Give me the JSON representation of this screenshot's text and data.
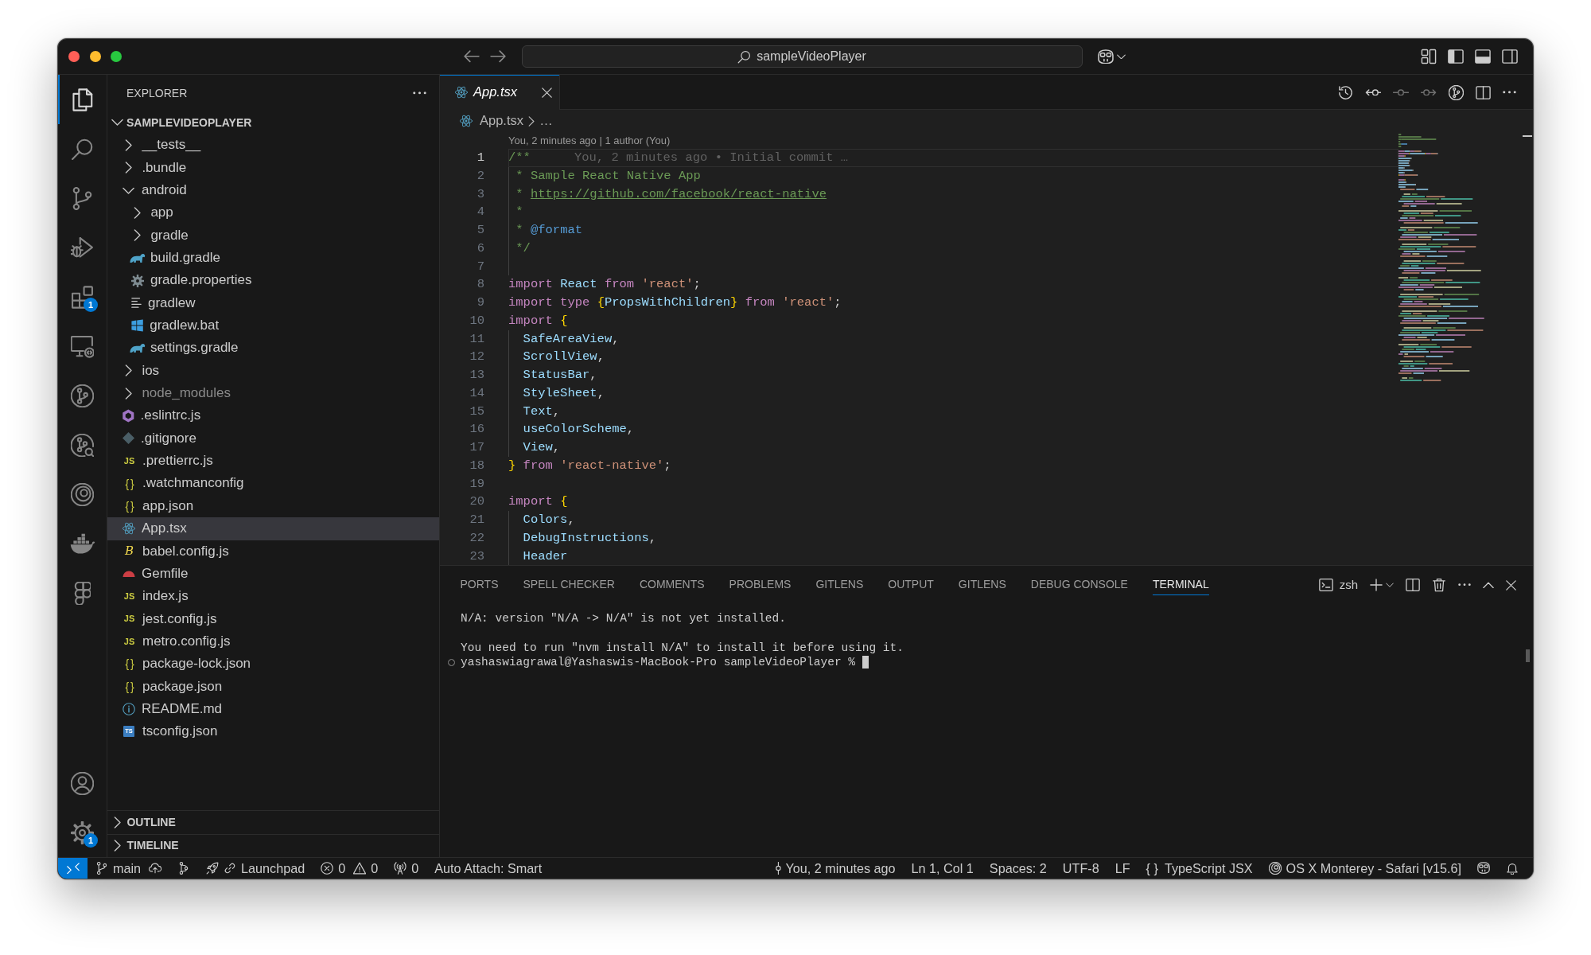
{
  "title_bar": {
    "command_center": {
      "label": "sampleVideoPlayer"
    }
  },
  "activity_bar": {
    "items": [
      {
        "kind": "explorer",
        "selected": true
      },
      {
        "kind": "search",
        "selected": false
      },
      {
        "kind": "source-control",
        "selected": false
      },
      {
        "kind": "run-debug",
        "selected": false
      },
      {
        "kind": "extensions",
        "selected": false,
        "badge": "1"
      },
      {
        "kind": "remote",
        "selected": false
      },
      {
        "kind": "gitlens",
        "selected": false
      },
      {
        "kind": "gitlens-inspect",
        "selected": false
      },
      {
        "kind": "spiral",
        "selected": false
      },
      {
        "kind": "docker",
        "selected": false
      },
      {
        "kind": "shapes",
        "selected": false
      }
    ],
    "bottom": [
      {
        "kind": "account"
      },
      {
        "kind": "manage",
        "badge": "1"
      }
    ]
  },
  "sidebar": {
    "title": "EXPLORER",
    "sections": [
      {
        "title": "SAMPLEVIDEOPLAYER",
        "expanded": true,
        "tree": [
          {
            "label": "__tests__",
            "kind": "folder",
            "expanded": false,
            "selected": false,
            "ignored": false
          },
          {
            "label": ".bundle",
            "kind": "folder",
            "expanded": false,
            "selected": false,
            "ignored": false
          },
          {
            "label": "android",
            "kind": "folder",
            "expanded": true,
            "selected": false,
            "ignored": false,
            "children": [
              {
                "label": "app",
                "kind": "folder",
                "expanded": false,
                "selected": false,
                "ignored": false
              },
              {
                "label": "gradle",
                "kind": "folder",
                "expanded": false,
                "selected": false,
                "ignored": false
              },
              {
                "label": "build.gradle",
                "kind": "gradle",
                "selected": false,
                "ignored": false
              },
              {
                "label": "gradle.properties",
                "kind": "properties",
                "selected": false,
                "ignored": false
              },
              {
                "label": "gradlew",
                "kind": "text",
                "selected": false,
                "ignored": false
              },
              {
                "label": "gradlew.bat",
                "kind": "batch",
                "selected": false,
                "ignored": false
              },
              {
                "label": "settings.gradle",
                "kind": "gradle",
                "selected": false,
                "ignored": false
              }
            ]
          },
          {
            "label": "ios",
            "kind": "folder",
            "expanded": false,
            "selected": false,
            "ignored": false
          },
          {
            "label": "node_modules",
            "kind": "folder",
            "expanded": false,
            "selected": false,
            "ignored": true
          },
          {
            "label": ".eslintrc.js",
            "kind": "eslint",
            "selected": false,
            "ignored": false
          },
          {
            "label": ".gitignore",
            "kind": "git",
            "selected": false,
            "ignored": false
          },
          {
            "label": ".prettierrc.js",
            "kind": "js",
            "icon_text": "JS",
            "selected": false,
            "ignored": false
          },
          {
            "label": ".watchmanconfig",
            "kind": "json",
            "icon_text": "{ }",
            "selected": false,
            "ignored": false
          },
          {
            "label": "app.json",
            "kind": "json",
            "icon_text": "{ }",
            "selected": false,
            "ignored": false
          },
          {
            "label": "App.tsx",
            "kind": "react",
            "selected": true,
            "ignored": false
          },
          {
            "label": "babel.config.js",
            "kind": "babel",
            "icon_text": "B",
            "selected": false,
            "ignored": false
          },
          {
            "label": "Gemfile",
            "kind": "ruby",
            "selected": false,
            "ignored": false
          },
          {
            "label": "index.js",
            "kind": "js",
            "icon_text": "JS",
            "selected": false,
            "ignored": false
          },
          {
            "label": "jest.config.js",
            "kind": "js",
            "icon_text": "JS",
            "selected": false,
            "ignored": false
          },
          {
            "label": "metro.config.js",
            "kind": "js",
            "icon_text": "JS",
            "selected": false,
            "ignored": false
          },
          {
            "label": "package-lock.json",
            "kind": "json",
            "icon_text": "{ }",
            "selected": false,
            "ignored": false
          },
          {
            "label": "package.json",
            "kind": "json",
            "icon_text": "{ }",
            "selected": false,
            "ignored": false
          },
          {
            "label": "README.md",
            "kind": "markdown",
            "selected": false,
            "ignored": false
          },
          {
            "label": "tsconfig.json",
            "kind": "ts",
            "icon_text": "TS",
            "selected": false,
            "ignored": false
          }
        ]
      },
      {
        "title": "OUTLINE",
        "expanded": false
      },
      {
        "title": "TIMELINE",
        "expanded": false
      }
    ]
  },
  "editor": {
    "tabs": [
      {
        "label": "App.tsx",
        "kind": "react",
        "selected": true,
        "preview": true
      }
    ],
    "breadcrumbs": [
      {
        "label": "App.tsx",
        "kind": "react"
      },
      {
        "label": "…"
      }
    ],
    "codelens": "You, 2 minutes ago | 1 author (You)",
    "lines": [
      {
        "number": "1",
        "current": true,
        "tokens": [
          {
            "kind": "comment",
            "text": "/**"
          }
        ],
        "blame": "You, 2 minutes ago • Initial commit …"
      },
      {
        "number": "2",
        "current": false,
        "tokens": [
          {
            "kind": "comment",
            "text": " * Sample React Native App"
          }
        ]
      },
      {
        "number": "3",
        "current": false,
        "tokens": [
          {
            "kind": "comment",
            "text": " * "
          },
          {
            "kind": "link",
            "text": "https://github.com/facebook/react-native"
          }
        ]
      },
      {
        "number": "4",
        "current": false,
        "tokens": [
          {
            "kind": "comment",
            "text": " *"
          }
        ]
      },
      {
        "number": "5",
        "current": false,
        "tokens": [
          {
            "kind": "comment",
            "text": " * "
          },
          {
            "kind": "doc-tag",
            "text": "@format"
          }
        ]
      },
      {
        "number": "6",
        "current": false,
        "tokens": [
          {
            "kind": "comment",
            "text": " */"
          }
        ]
      },
      {
        "number": "7",
        "current": false
      },
      {
        "number": "8",
        "current": false,
        "tokens": [
          {
            "kind": "keyword",
            "text": "import "
          },
          {
            "kind": "variable",
            "text": "React "
          },
          {
            "kind": "keyword",
            "text": "from "
          },
          {
            "kind": "string",
            "text": "'react'"
          },
          {
            "kind": "plain",
            "text": ";"
          }
        ]
      },
      {
        "number": "9",
        "current": false,
        "tokens": [
          {
            "kind": "keyword",
            "text": "import type "
          },
          {
            "kind": "brace",
            "text": "{"
          },
          {
            "kind": "variable",
            "text": "PropsWithChildren"
          },
          {
            "kind": "brace",
            "text": "}"
          },
          {
            "kind": "keyword",
            "text": " from "
          },
          {
            "kind": "string",
            "text": "'react'"
          },
          {
            "kind": "plain",
            "text": ";"
          }
        ]
      },
      {
        "number": "10",
        "current": false,
        "tokens": [
          {
            "kind": "keyword",
            "text": "import "
          },
          {
            "kind": "brace",
            "text": "{"
          }
        ]
      },
      {
        "number": "11",
        "current": false,
        "tokens": [
          {
            "kind": "variable",
            "text": "  SafeAreaView"
          },
          {
            "kind": "plain",
            "text": ","
          }
        ]
      },
      {
        "number": "12",
        "current": false,
        "tokens": [
          {
            "kind": "variable",
            "text": "  ScrollView"
          },
          {
            "kind": "plain",
            "text": ","
          }
        ]
      },
      {
        "number": "13",
        "current": false,
        "tokens": [
          {
            "kind": "variable",
            "text": "  StatusBar"
          },
          {
            "kind": "plain",
            "text": ","
          }
        ]
      },
      {
        "number": "14",
        "current": false,
        "tokens": [
          {
            "kind": "variable",
            "text": "  StyleSheet"
          },
          {
            "kind": "plain",
            "text": ","
          }
        ]
      },
      {
        "number": "15",
        "current": false,
        "tokens": [
          {
            "kind": "variable",
            "text": "  Text"
          },
          {
            "kind": "plain",
            "text": ","
          }
        ]
      },
      {
        "number": "16",
        "current": false,
        "tokens": [
          {
            "kind": "variable",
            "text": "  useColorScheme"
          },
          {
            "kind": "plain",
            "text": ","
          }
        ]
      },
      {
        "number": "17",
        "current": false,
        "tokens": [
          {
            "kind": "variable",
            "text": "  View"
          },
          {
            "kind": "plain",
            "text": ","
          }
        ]
      },
      {
        "number": "18",
        "current": false,
        "tokens": [
          {
            "kind": "brace",
            "text": "}"
          },
          {
            "kind": "keyword",
            "text": " from "
          },
          {
            "kind": "string",
            "text": "'react-native'"
          },
          {
            "kind": "plain",
            "text": ";"
          }
        ]
      },
      {
        "number": "19",
        "current": false
      },
      {
        "number": "20",
        "current": false,
        "tokens": [
          {
            "kind": "keyword",
            "text": "import "
          },
          {
            "kind": "brace",
            "text": "{"
          }
        ]
      },
      {
        "number": "21",
        "current": false,
        "tokens": [
          {
            "kind": "variable",
            "text": "  Colors"
          },
          {
            "kind": "plain",
            "text": ","
          }
        ]
      },
      {
        "number": "22",
        "current": false,
        "tokens": [
          {
            "kind": "variable",
            "text": "  DebugInstructions"
          },
          {
            "kind": "plain",
            "text": ","
          }
        ]
      },
      {
        "number": "23",
        "current": false,
        "tokens": [
          {
            "kind": "variable",
            "text": "  Header"
          }
        ]
      }
    ]
  },
  "panel": {
    "tabs": [
      {
        "label": "PORTS",
        "selected": false
      },
      {
        "label": "SPELL CHECKER",
        "selected": false
      },
      {
        "label": "COMMENTS",
        "selected": false
      },
      {
        "label": "PROBLEMS",
        "selected": false
      },
      {
        "label": "GITLENS",
        "selected": false
      },
      {
        "label": "OUTPUT",
        "selected": false
      },
      {
        "label": "GITLENS",
        "selected": false
      },
      {
        "label": "DEBUG CONSOLE",
        "selected": false
      },
      {
        "label": "TERMINAL",
        "selected": true
      }
    ],
    "terminal": {
      "shell": "zsh",
      "lines": [
        {
          "kind": "output",
          "text": "N/A: version \"N/A -> N/A\" is not yet installed."
        },
        {
          "kind": "blank"
        },
        {
          "kind": "output",
          "text": "You need to run \"nvm install N/A\" to install it before using it."
        },
        {
          "kind": "prompt",
          "text": "yashaswiagrawal@Yashaswis-MacBook-Pro sampleVideoPlayer %"
        }
      ]
    }
  },
  "status_bar": {
    "left": [
      {
        "kind": "remote"
      },
      {
        "kind": "branch",
        "label": "main"
      },
      {
        "kind": "publish"
      },
      {
        "kind": "graph"
      },
      {
        "kind": "launchpad",
        "label": "Launchpad"
      },
      {
        "kind": "problems",
        "errors": "0",
        "warnings": "0"
      },
      {
        "kind": "ports",
        "label": "0"
      },
      {
        "kind": "auto-attach",
        "label": "Auto Attach: Smart"
      }
    ],
    "right": [
      {
        "kind": "blame",
        "label": "You, 2 minutes ago"
      },
      {
        "kind": "cursor",
        "label": "Ln 1, Col 1"
      },
      {
        "kind": "indentation",
        "label": "Spaces: 2"
      },
      {
        "kind": "encoding",
        "label": "UTF-8"
      },
      {
        "kind": "eol",
        "label": "LF"
      },
      {
        "kind": "language",
        "icon_text": "{ }",
        "label": "TypeScript JSX"
      },
      {
        "kind": "browser",
        "label": "OS X Monterey - Safari [v15.6]"
      },
      {
        "kind": "copilot"
      },
      {
        "kind": "notifications"
      }
    ]
  }
}
